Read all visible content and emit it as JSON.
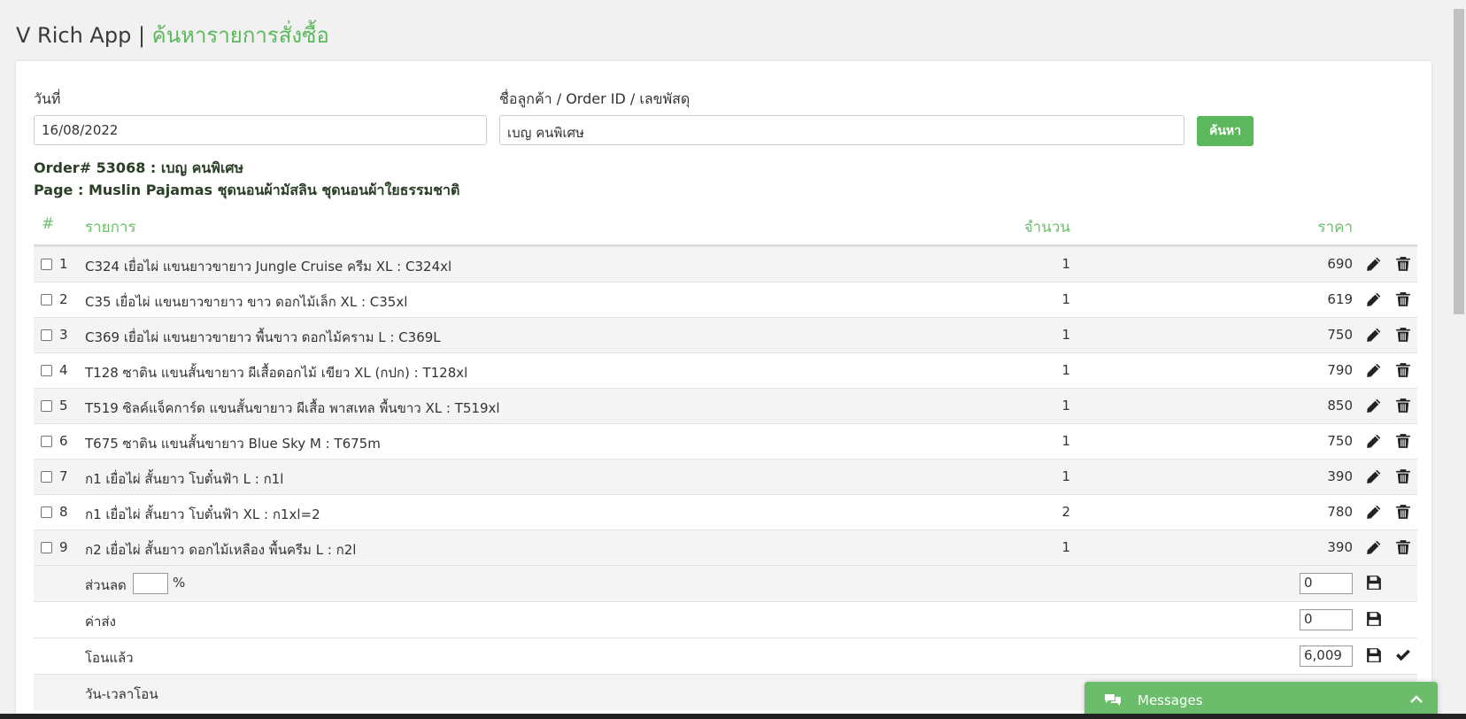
{
  "header": {
    "app_name": "V Rich App |",
    "page_name": "ค้นหารายการสั่งซื้อ"
  },
  "search": {
    "date_label": "วันที่",
    "date_value": "16/08/2022",
    "query_label": "ชื่อลูกค้า / Order ID / เลขพัสดุ",
    "query_value": "เบญ คนพิเศษ",
    "search_button": "ค้นหา"
  },
  "order": {
    "title": "Order# 53068 : เบญ คนพิเศษ",
    "page_line": "Page : Muslin Pajamas ชุดนอนผ้ามัสลิน ชุดนอนผ้าใยธรรมชาติ"
  },
  "table": {
    "headers": {
      "num": "#",
      "item": "รายการ",
      "qty": "จำนวน",
      "price": "ราคา"
    },
    "rows": [
      {
        "num": "1",
        "item": "C324 เยื่อไผ่ แขนยาวขายาว Jungle Cruise ครีม XL : C324xl",
        "qty": "1",
        "price": "690"
      },
      {
        "num": "2",
        "item": "C35 เยื่อไผ่ แขนยาวขายาว ขาว ดอกไม้เล็ก XL : C35xl",
        "qty": "1",
        "price": "619"
      },
      {
        "num": "3",
        "item": "C369 เยื่อไผ่ แขนยาวขายาว พื้นขาว ดอกไม้คราม L : C369L",
        "qty": "1",
        "price": "750"
      },
      {
        "num": "4",
        "item": "T128 ซาติน แขนสั้นขายาว ผีเสื้อดอกไม้ เขียว XL (กปก) : T128xl",
        "qty": "1",
        "price": "790"
      },
      {
        "num": "5",
        "item": "T519 ซิลค์แจ็คการ์ด แขนสั้นขายาว ผีเสื้อ พาสเทล พื้นขาว XL : T519xl",
        "qty": "1",
        "price": "850"
      },
      {
        "num": "6",
        "item": "T675 ซาติน แขนสั้นขายาว Blue Sky M : T675m",
        "qty": "1",
        "price": "750"
      },
      {
        "num": "7",
        "item": "ก1 เยื่อไผ่ สั้นยาว โบตั๋นฟ้า L : ก1l",
        "qty": "1",
        "price": "390"
      },
      {
        "num": "8",
        "item": "ก1 เยื่อไผ่ สั้นยาว โบตั๋นฟ้า XL : ก1xl=2",
        "qty": "2",
        "price": "780"
      },
      {
        "num": "9",
        "item": "ก2 เยื่อไผ่ สั้นยาว ดอกไม้เหลือง พื้นครีม L : ก2l",
        "qty": "1",
        "price": "390"
      }
    ]
  },
  "summary": {
    "discount_label": "ส่วนลด",
    "discount_percent_value": "",
    "percent_sign": "%",
    "discount_value": "0",
    "shipping_label": "ค่าส่ง",
    "shipping_value": "0",
    "paid_label": "โอนแล้ว",
    "paid_value": "6,009",
    "transfer_time_label": "วัน-เวลาโอน"
  },
  "messages": {
    "label": "Messages"
  },
  "colors": {
    "accent": "#5cb85c",
    "header_text": "#6cbf6c",
    "messages_bg": "#6bbd6b"
  },
  "icons": [
    "pencil-icon",
    "trash-icon",
    "save-icon",
    "check-icon",
    "chat-icon",
    "chevron-up-icon"
  ]
}
